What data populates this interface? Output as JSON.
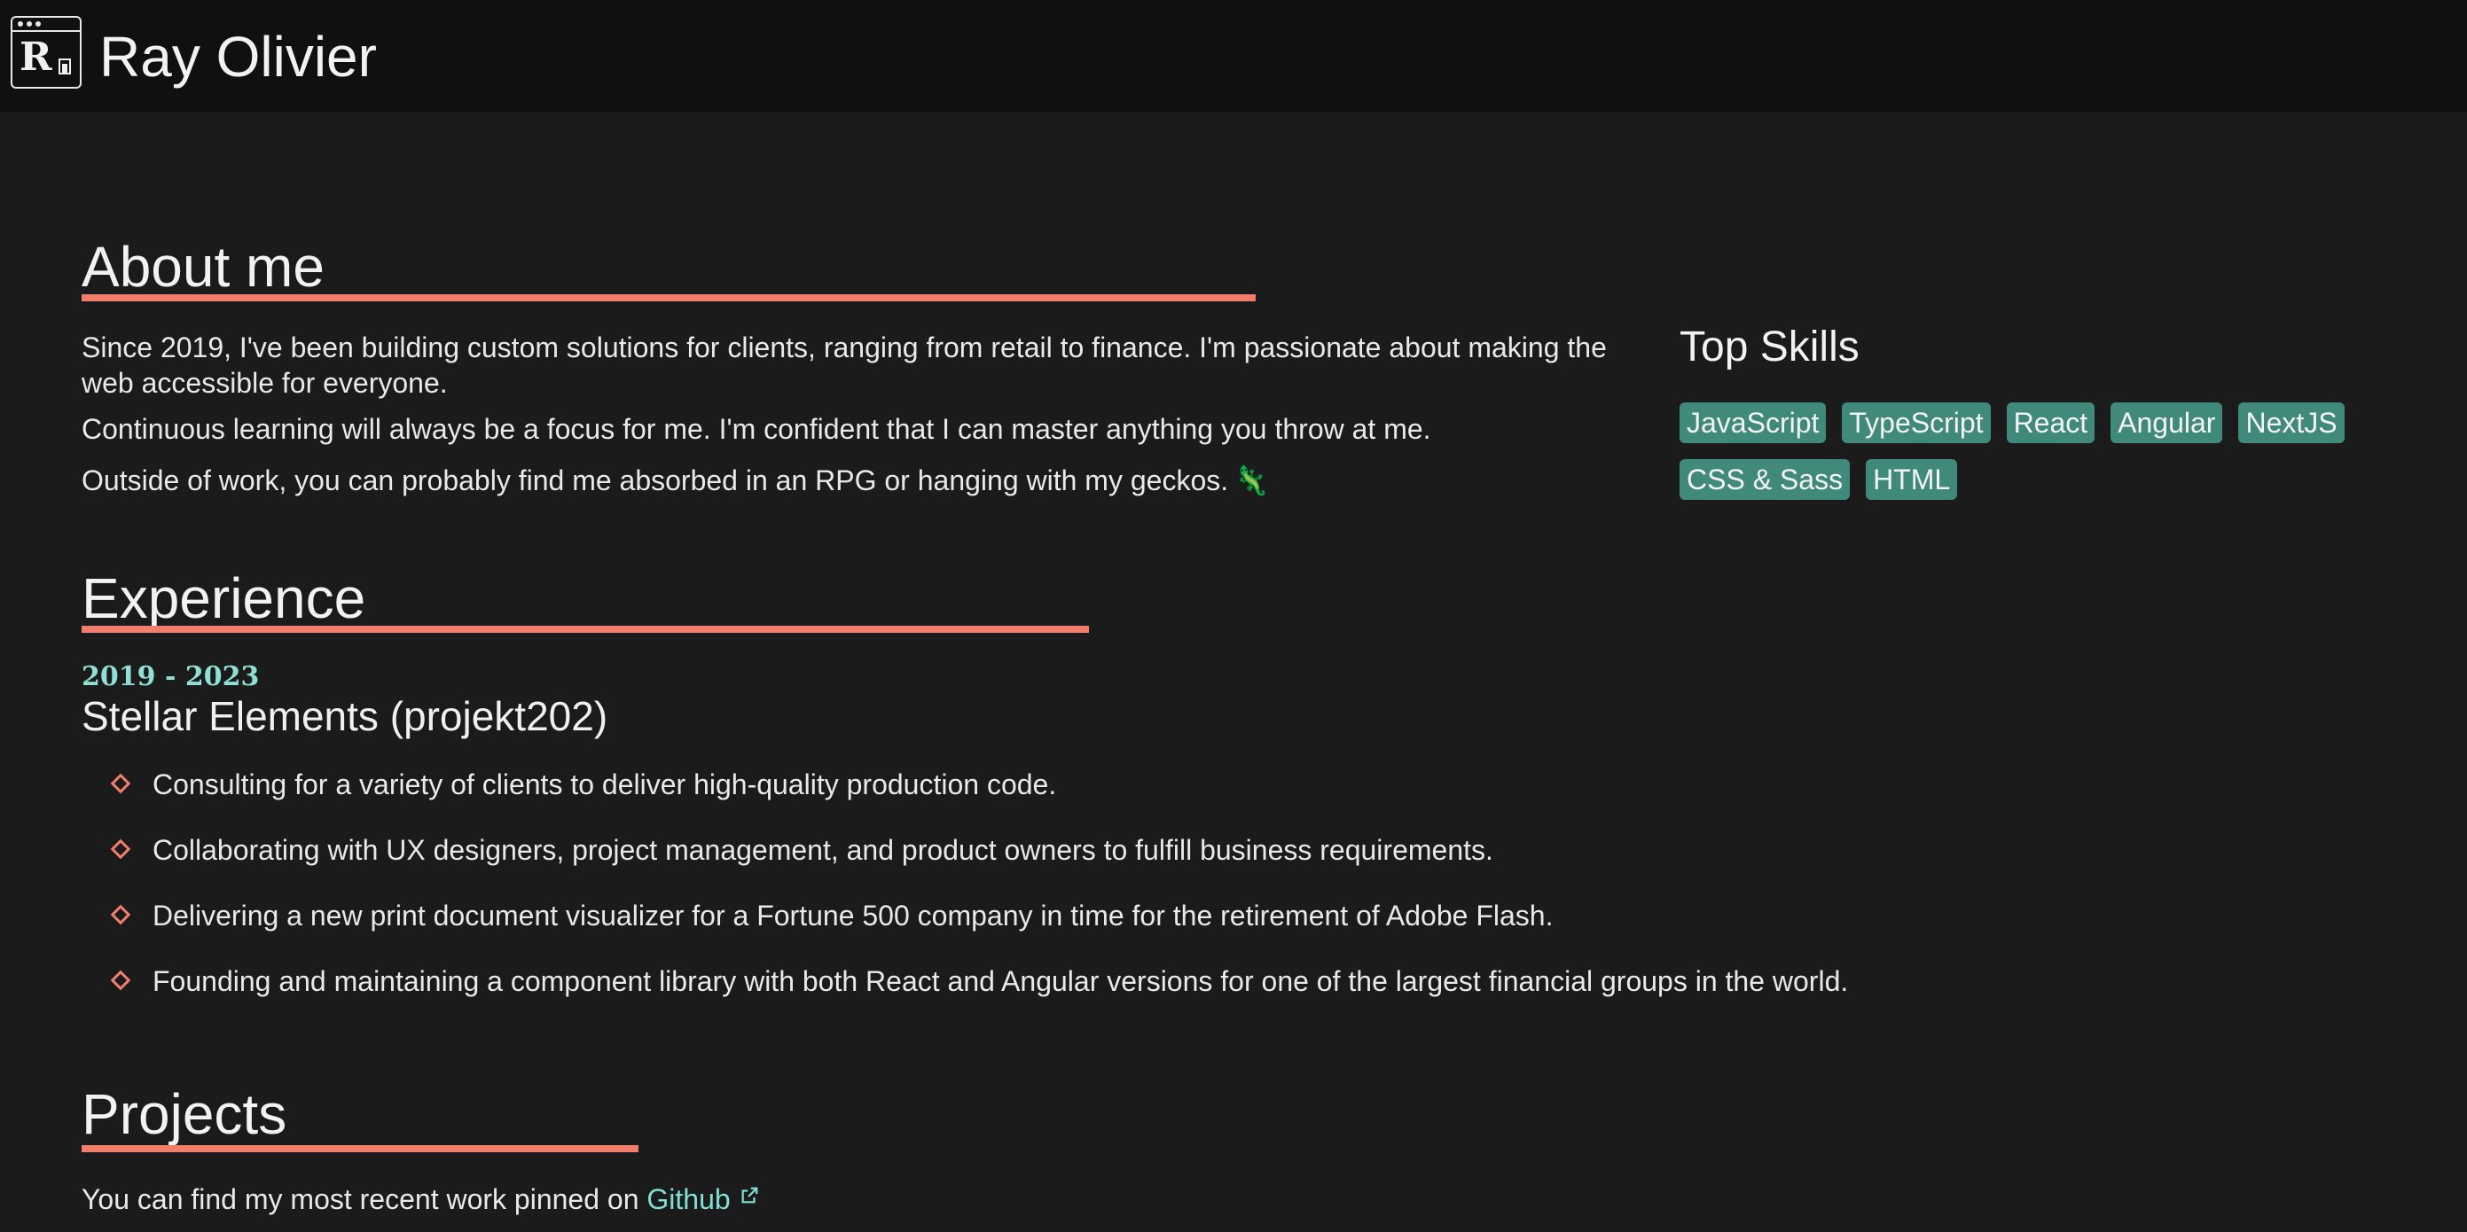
{
  "header": {
    "logo_letter": "R",
    "site_name": "Ray Olivier"
  },
  "about": {
    "title": "About me",
    "paragraphs": [
      "Since 2019, I've been building custom solutions for clients, ranging from retail to finance. I'm passionate about making the web accessible for everyone.",
      "Continuous learning will always be a focus for me. I'm confident that I can master anything you throw at me.",
      "Outside of work, you can probably find me absorbed in an RPG or hanging with my geckos."
    ],
    "gecko_icon": "gecko-icon"
  },
  "skills": {
    "title": "Top Skills",
    "items": [
      "JavaScript",
      "TypeScript",
      "React",
      "Angular",
      "NextJS",
      "CSS & Sass",
      "HTML"
    ]
  },
  "experience": {
    "title": "Experience",
    "jobs": [
      {
        "years": "2019 - 2023",
        "company": "Stellar Elements (projekt202)",
        "bullets": [
          "Consulting for a variety of clients to deliver high-quality production code.",
          "Collaborating with UX designers, project management, and product owners to fulfill business requirements.",
          "Delivering a new print document visualizer for a Fortune 500 company in time for the retirement of Adobe Flash.",
          "Founding and maintaining a component library with both React and Angular versions for one of the largest financial groups in the world."
        ]
      }
    ]
  },
  "projects": {
    "title": "Projects",
    "text": "You can find my most recent work pinned on",
    "link_label": "Github",
    "link_icon": "external-link-icon"
  },
  "colors": {
    "background": "#1b1b1b",
    "header_background": "#101010",
    "accent_underline": "#f07e6a",
    "chip_background": "#408a7c",
    "link": "#7fe0d3"
  }
}
